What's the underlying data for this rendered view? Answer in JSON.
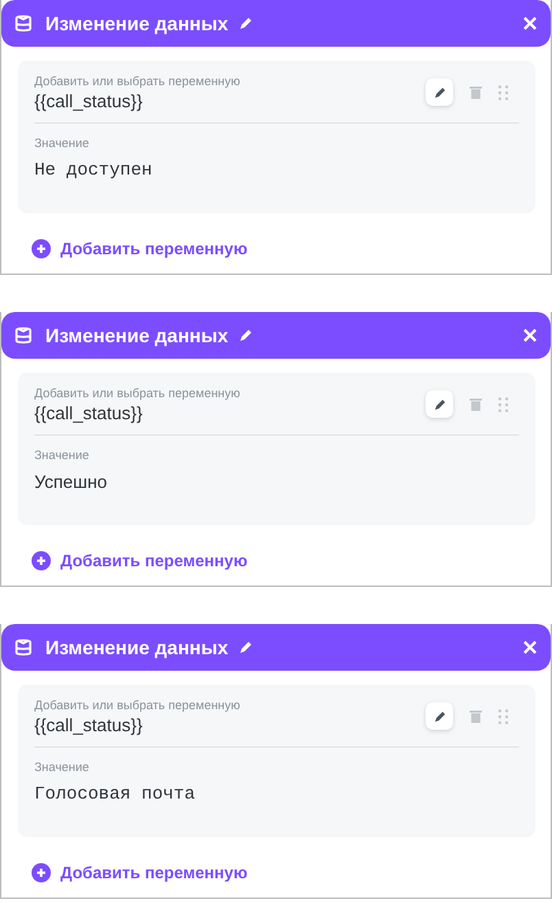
{
  "panels": [
    {
      "title": "Изменение данных",
      "variable_label": "Добавить или выбрать переменную",
      "variable": "{{call_status}}",
      "value_label": "Значение",
      "value": "Не доступен",
      "monospace": true,
      "add_link": "Добавить переменную"
    },
    {
      "title": "Изменение данных",
      "variable_label": "Добавить или выбрать переменную",
      "variable": "{{call_status}}",
      "value_label": "Значение",
      "value": "Успешно",
      "monospace": false,
      "add_link": "Добавить переменную"
    },
    {
      "title": "Изменение данных",
      "variable_label": "Добавить или выбрать переменную",
      "variable": "{{call_status}}",
      "value_label": "Значение",
      "value": "Голосовая почта",
      "monospace": true,
      "add_link": "Добавить переменную"
    }
  ]
}
